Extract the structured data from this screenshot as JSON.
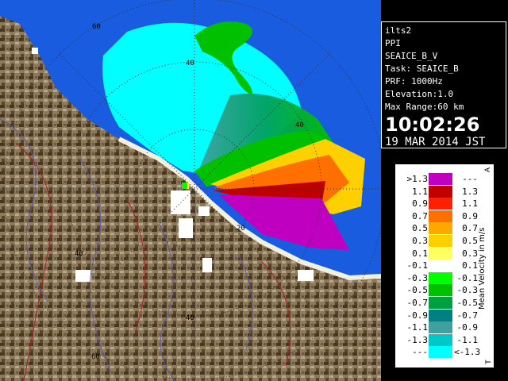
{
  "colors": {
    "sea": "#1a5ce0",
    "land_light": "#8c7a5c",
    "land_dark": "#3e2c18",
    "snow": "#ffffff",
    "range_ring": "#303030",
    "river": "#5a5aa8",
    "road": "#b02020"
  },
  "map": {
    "range_ring_labels": [
      "20",
      "40",
      "60",
      "40",
      "40",
      "40",
      "60"
    ]
  },
  "info": {
    "radar": "ilts2",
    "scan_type": "PPI",
    "product": "SEAICE_B_V",
    "task": "Task: SEAICE_B",
    "prf": "PRF: 1000Hz",
    "elevation": "Elevation:1.0",
    "max_range": "Max Range:60 km",
    "time": "10:02:26",
    "date": "19 MAR 2014 JST"
  },
  "legend": {
    "title": "Mean Velocity in m/s",
    "corner_top": "A",
    "corner_bottom": "T",
    "rows": [
      {
        "left": ">1.3",
        "right": "---",
        "color": "#c000c0"
      },
      {
        "left": "1.1",
        "right": "1.3",
        "color": "#c00000"
      },
      {
        "left": "0.9",
        "right": "1.1",
        "color": "#ff2000"
      },
      {
        "left": "0.7",
        "right": "0.9",
        "color": "#ff7000"
      },
      {
        "left": "0.5",
        "right": "0.7",
        "color": "#ffa800"
      },
      {
        "left": "0.3",
        "right": "0.5",
        "color": "#ffd000"
      },
      {
        "left": "0.1",
        "right": "0.3",
        "color": "#ffff60"
      },
      {
        "left": "-0.1",
        "right": "0.1",
        "color": "#ffffff"
      },
      {
        "left": "-0.3",
        "right": "-0.1",
        "color": "#00ff00"
      },
      {
        "left": "-0.5",
        "right": "-0.3",
        "color": "#00c000"
      },
      {
        "left": "-0.7",
        "right": "-0.5",
        "color": "#00a040"
      },
      {
        "left": "-0.9",
        "right": "-0.7",
        "color": "#008080"
      },
      {
        "left": "-1.1",
        "right": "-0.9",
        "color": "#40a0a0"
      },
      {
        "left": "-1.3",
        "right": "-1.1",
        "color": "#00c8c8"
      },
      {
        "left": "---",
        "right": "<-1.3",
        "color": "#00ffff"
      }
    ]
  }
}
